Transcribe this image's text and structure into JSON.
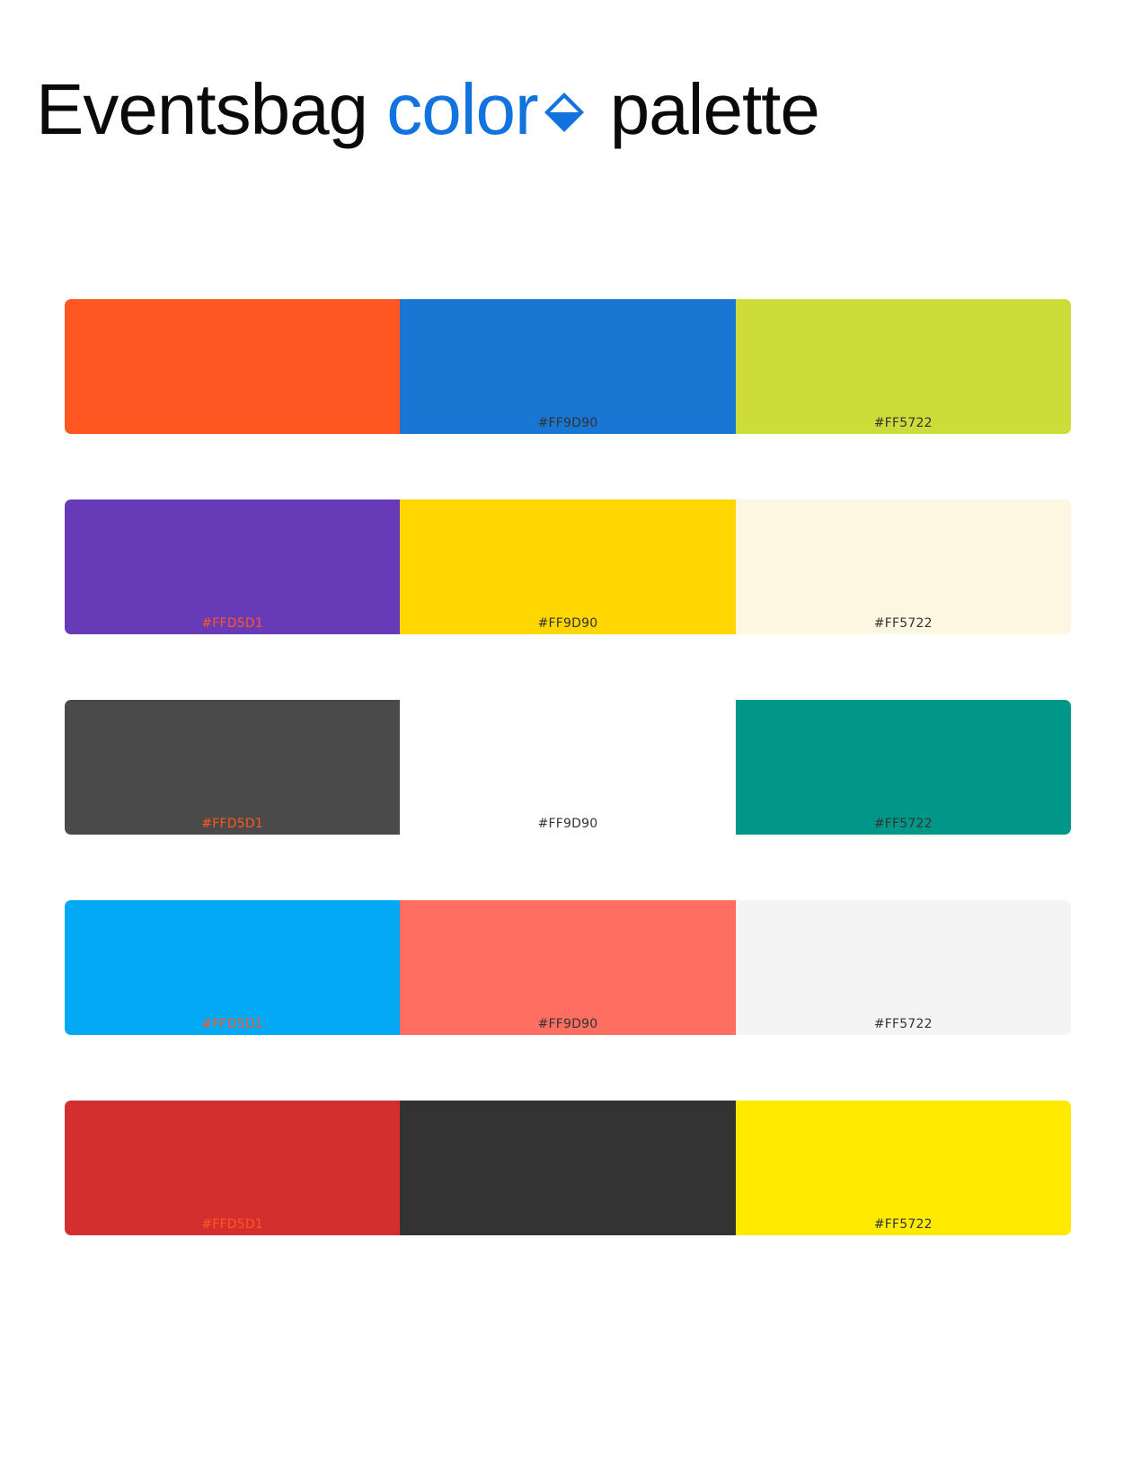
{
  "title": {
    "part1": "Eventsbag",
    "part2": "color",
    "part3": "palette",
    "accent_color": "#1273de",
    "icon": "drop-icon"
  },
  "palette": [
    [
      {
        "color": "#FF5722",
        "hex": "",
        "label_color": "#FF5722"
      },
      {
        "color": "#1976D2",
        "hex": "#FF9D90",
        "label_color": "#333333"
      },
      {
        "color": "#CDDC39",
        "hex": "#FF5722",
        "label_color": "#333333"
      }
    ],
    [
      {
        "color": "#673AB7",
        "hex": "#FFD5D1",
        "label_color": "#FF5722"
      },
      {
        "color": "#FFD600",
        "hex": "#FF9D90",
        "label_color": "#333333"
      },
      {
        "color": "#FDF7E1",
        "hex": "#FF5722",
        "label_color": "#333333"
      }
    ],
    [
      {
        "color": "#4A4A4A",
        "hex": "#FFD5D1",
        "label_color": "#FF5722"
      },
      {
        "color": "#FFFFFF",
        "hex": "#FF9D90",
        "label_color": "#333333"
      },
      {
        "color": "#009688",
        "hex": "#FF5722",
        "label_color": "#333333"
      }
    ],
    [
      {
        "color": "#03A9F4",
        "hex": "#FFD5D1",
        "label_color": "#FF5722"
      },
      {
        "color": "#FF6F61",
        "hex": "#FF9D90",
        "label_color": "#333333"
      },
      {
        "color": "#F4F4F4",
        "hex": "#FF5722",
        "label_color": "#333333"
      }
    ],
    [
      {
        "color": "#D32F2F",
        "hex": "#FFD5D1",
        "label_color": "#FF5722"
      },
      {
        "color": "#333333",
        "hex": "",
        "label_color": "#333333"
      },
      {
        "color": "#FFEA00",
        "hex": "#FF5722",
        "label_color": "#333333"
      }
    ]
  ]
}
